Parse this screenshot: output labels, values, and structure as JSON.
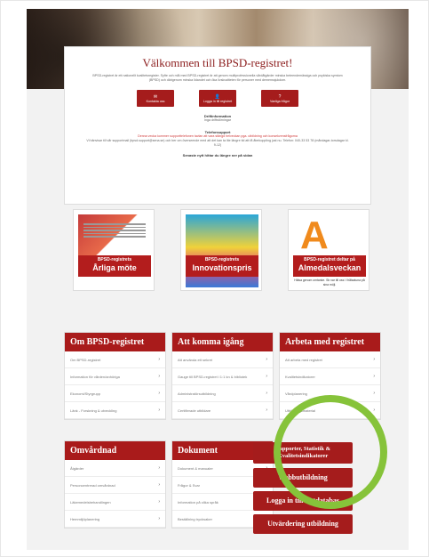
{
  "welcome": {
    "title": "Välkommen till BPSD-registret!",
    "intro": "BPSD-registret är ett nationellt kvalitetsregister. Syfte och mål med BPSD-registret är att genom multiprofessionella vårdåtgärder minska beteendemässiga och psykiska symtom (BPSD) och därigenom minska lidandet och öka livskvaliteten för personer med demenssjukdom.",
    "buttons": [
      {
        "icon": "✉",
        "label": "Kontakta oss"
      },
      {
        "icon": "👤",
        "label": "Logga in till registret"
      },
      {
        "icon": "?",
        "label": "Vanliga frågor"
      }
    ],
    "drift_title": "Driftinformation",
    "drift_text": "Inga driftstörningar",
    "support_title": "Telefonsupport",
    "support_red": "Denna vecka kommer supporttelefonen tavlan att vara stängd helveckan pga. utbildning och konsekvensfrågorna",
    "support_text": "Vi hänvisar till vår supportmail (bpsd.support@sena.se) och ber om överseende med att det kan ta lite längre tid att få återkoppling just nu. Telefon: 040-33 53 78 (måndagar-torsdagar kl. 9-12)",
    "footer": "Senaste nytt hittar du längre ner på sidan"
  },
  "promos": [
    {
      "small": "BPSD-registrets",
      "big": "Årliga möte",
      "sub": ""
    },
    {
      "small": "BPSD-registrets",
      "big": "Innovationspris",
      "sub": ""
    },
    {
      "small": "BPSD-registret deltar på",
      "big": "Almedalsveckan",
      "sub": "Hälsa genom omtanke. Sb var till oss i Vrålsatuna på sina möjl."
    }
  ],
  "panels": {
    "om": {
      "title": "Om BPSD-registret",
      "rows": [
        "Om BPSD-registret",
        "Information för vården/anhöriga",
        "Ekonomi/Styrgrupp",
        "Länk - Forskning & utveckling"
      ]
    },
    "komma": {
      "title": "Att komma igång",
      "rows": [
        "Att använda ett sekret",
        "Gauge till BPSD-registret i 1:1 kn & bibliotek",
        "Administratörsutbildning",
        "Certifierade utbildare"
      ]
    },
    "arbeta": {
      "title": "Arbeta med registret",
      "rows": [
        "Att arbeta med registret",
        "Kvalitetsindikatorer",
        "Vårdplanering",
        "Utbildningsmaterial"
      ]
    },
    "omvardnad": {
      "title": "Omvårdnad",
      "rows": [
        "Åtgärder",
        "Personcentrerad omvårdnad",
        "Läkemedelsbehandlingen",
        "Hemmiljöplanering"
      ]
    },
    "dokument": {
      "title": "Dokument",
      "rows": [
        "Dokument & manualer",
        "Frågor & Svar",
        "Information på olika språk",
        "Beställning trycksaker"
      ]
    }
  },
  "action_buttons": [
    "Rapporter, Statistik & Kvalitetsindikatorer",
    "Webbutbildning",
    "Logga in till testdatabas",
    "Utvärdering utbildning"
  ],
  "colors": {
    "accent": "#a51c1c",
    "highlight": "#86c33a"
  }
}
